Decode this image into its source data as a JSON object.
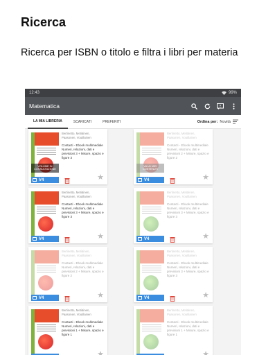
{
  "promo": {
    "title": "Ricerca",
    "subtitle": "Ricerca per ISBN o titolo e filtra i libri per materia"
  },
  "statusbar": {
    "time": "12:43",
    "battery": "99%"
  },
  "appbar": {
    "title": "Matematica",
    "icons": [
      "search-icon",
      "refresh-icon",
      "message-icon",
      "more-vert-icon"
    ]
  },
  "tabs": [
    {
      "label": "LA MIA LIBRERIA",
      "active": true
    },
    {
      "label": "SCARICATI",
      "active": false
    },
    {
      "label": "PREFERITI",
      "active": false
    }
  ],
  "order": {
    "label": "Ordina per:",
    "value": "Novità"
  },
  "books": [
    {
      "authors": "Bertinetto, Metiäinen, Paasonen, Voutilainen",
      "description": "Contacti - Ebook multimediale Numeri, relazioni, dati e previsioni 3 + Misure, spazio e figure 3",
      "overlay": "VOLUME IN CONSULTAZIONE",
      "version": "V4",
      "faded": false,
      "cover": "red"
    },
    {
      "authors": "Bertinetto, Metiäinen, Paasonen, Voutilainen",
      "description": "Contacti - Ebook multimediale Numeri, relazioni, dati e previsioni 2 + Misure, spazio e figure 2",
      "overlay": "VAI AI MIEI CONTENUTI",
      "version": "V4",
      "faded": true,
      "cover": "red"
    },
    {
      "authors": "Bertinetto, Metiäinen, Paasonen, Voutilainen",
      "description": "Contacti - Ebook multimediale Numeri, relazioni, dati e previsioni 3 + Misure, spazio e figure 3",
      "overlay": "",
      "version": "V4",
      "faded": false,
      "cover": "red"
    },
    {
      "authors": "Bertinetto, Metiäinen, Paasonen, Voutilainen",
      "description": "Contacti - Ebook multimediale Numeri, relazioni, dati e previsioni 3 + Misure, spazio e figure 3",
      "overlay": "",
      "version": "V4",
      "faded": true,
      "cover": "green"
    },
    {
      "authors": "Bertinetto, Metiäinen, Paasonen, Voutilainen",
      "description": "Contacti - Ebook multimediale Numeri, relazioni, dati e previsioni 2 + Misure, spazio e figure 2",
      "overlay": "",
      "version": "V4",
      "faded": true,
      "cover": "red"
    },
    {
      "authors": "Bertinetto, Metiäinen, Paasonen, Voutilainen",
      "description": "Contacti - Ebook multimediale Numeri, relazioni, dati e previsioni 3 + Misure, spazio e figure 3",
      "overlay": "",
      "version": "V4",
      "faded": true,
      "cover": "green"
    },
    {
      "authors": "Bertinetto, Metiäinen, Paasonen, Voutilainen",
      "description": "Contacti - Ebook multimediale Numeri, relazioni, dati e previsioni 1 + Misure, spazio e figure 1",
      "overlay": "",
      "version": "V4",
      "faded": false,
      "cover": "red"
    },
    {
      "authors": "Bertinetto, Metiäinen, Paasonen, Voutilainen",
      "description": "Contacti - Ebook multimediale Numeri, relazioni, dati e previsioni 1 + Misure, spazio e figure 1",
      "overlay": "",
      "version": "V4",
      "faded": true,
      "cover": "green"
    }
  ],
  "colors": {
    "appbar": "#505357",
    "version_badge": "#3b8de0",
    "trash": "#e0463a"
  }
}
